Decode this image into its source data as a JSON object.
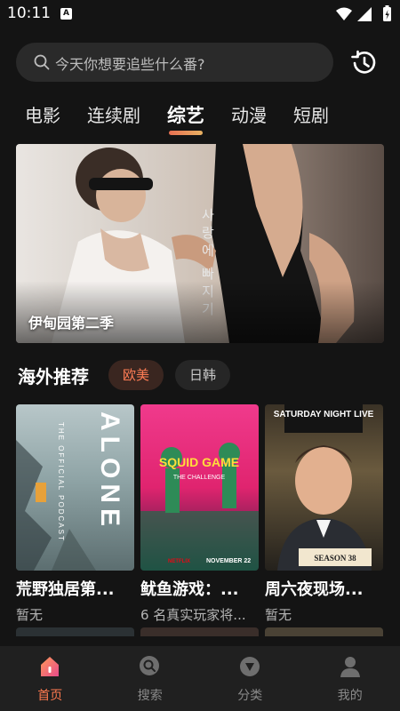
{
  "status_bar": {
    "time": "10:11",
    "notification_glyph": "A"
  },
  "search": {
    "placeholder": "今天你想要追些什么番?",
    "icon": "search-icon",
    "history_icon": "history-icon"
  },
  "tabs": [
    {
      "label": "电影",
      "active": false
    },
    {
      "label": "连续剧",
      "active": false
    },
    {
      "label": "综艺",
      "active": true
    },
    {
      "label": "动漫",
      "active": false
    },
    {
      "label": "短剧",
      "active": false
    }
  ],
  "banner": {
    "title": "伊甸园第二季",
    "poster_text": "사랑에 빠지기 와"
  },
  "overseas": {
    "title": "海外推荐",
    "filters": [
      {
        "label": "欧美",
        "active": true
      },
      {
        "label": "日韩",
        "active": false
      }
    ],
    "cards": [
      {
        "title": "荒野独居第...",
        "subtitle": "暂无",
        "poster_text": [
          "ALONE",
          "THE OFFICIAL PODCAST"
        ]
      },
      {
        "title": "鱿鱼游戏：...",
        "subtitle": "6 名真实玩家将...",
        "poster_text": [
          "SQUID GAME",
          "THE CHALLENGE",
          "NOVEMBER 22",
          "NETFLIX"
        ]
      },
      {
        "title": "周六夜现场...",
        "subtitle": "暂无",
        "poster_text": [
          "SATURDAY NIGHT LIVE",
          "SEASON 38"
        ]
      }
    ]
  },
  "bottom_nav": [
    {
      "label": "首页",
      "icon": "home-icon",
      "active": true
    },
    {
      "label": "搜索",
      "icon": "search-icon",
      "active": false
    },
    {
      "label": "分类",
      "icon": "category-icon",
      "active": false
    },
    {
      "label": "我的",
      "icon": "profile-icon",
      "active": false
    }
  ],
  "colors": {
    "accent": "#ff7a4f",
    "background": "#141414",
    "search_bg": "#2a2a2a",
    "nav_bg": "#202020"
  }
}
